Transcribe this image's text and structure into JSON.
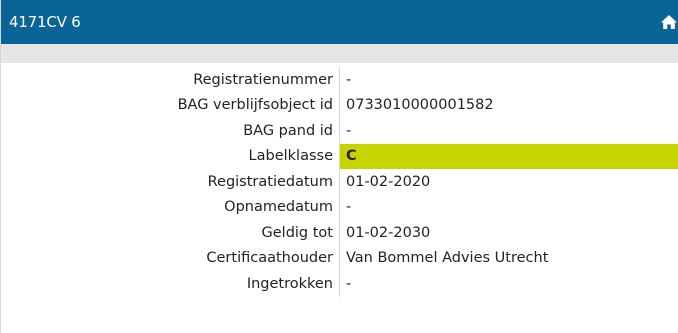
{
  "header": {
    "title": "4171CV 6",
    "home_icon": "home-icon"
  },
  "colors": {
    "header_bg": "#0a6497",
    "subbar_bg": "#e6e6e6",
    "label_highlight": "#c8d400"
  },
  "details": [
    {
      "label": "Registratienummer",
      "value": "-"
    },
    {
      "label": "BAG verblijfsobject id",
      "value": "0733010000001582"
    },
    {
      "label": "BAG pand id",
      "value": "-"
    },
    {
      "label": "Labelklasse",
      "value": "C",
      "highlight": true
    },
    {
      "label": "Registratiedatum",
      "value": "01-02-2020"
    },
    {
      "label": "Opnamedatum",
      "value": "-"
    },
    {
      "label": "Geldig tot",
      "value": "01-02-2030"
    },
    {
      "label": "Certificaathouder",
      "value": "Van Bommel Advies Utrecht"
    },
    {
      "label": "Ingetrokken",
      "value": "-"
    }
  ]
}
